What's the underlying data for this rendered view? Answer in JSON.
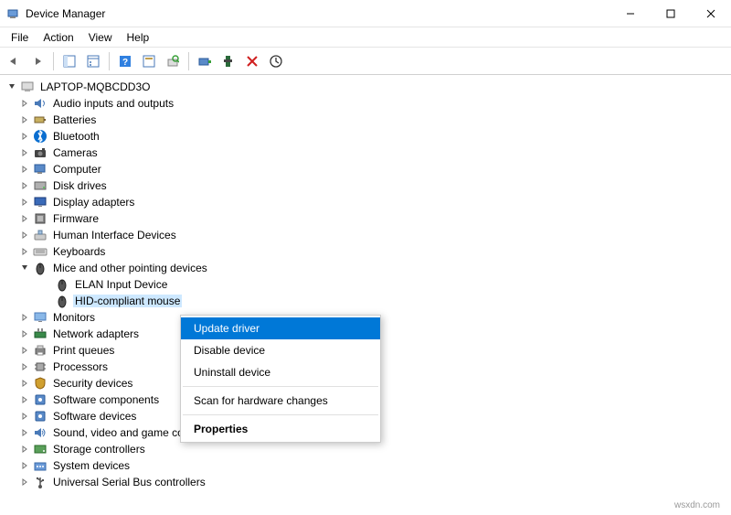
{
  "title": "Device Manager",
  "menubar": [
    "File",
    "Action",
    "View",
    "Help"
  ],
  "root": "LAPTOP-MQBCDD3O",
  "categories": [
    {
      "label": "Audio inputs and outputs",
      "icon": "audio"
    },
    {
      "label": "Batteries",
      "icon": "battery"
    },
    {
      "label": "Bluetooth",
      "icon": "bluetooth"
    },
    {
      "label": "Cameras",
      "icon": "camera"
    },
    {
      "label": "Computer",
      "icon": "computer"
    },
    {
      "label": "Disk drives",
      "icon": "disk"
    },
    {
      "label": "Display adapters",
      "icon": "display"
    },
    {
      "label": "Firmware",
      "icon": "firmware"
    },
    {
      "label": "Human Interface Devices",
      "icon": "hid"
    },
    {
      "label": "Keyboards",
      "icon": "keyboard"
    },
    {
      "label": "Mice and other pointing devices",
      "icon": "mouse",
      "expanded": true,
      "children": [
        {
          "label": "ELAN Input Device",
          "icon": "mouse"
        },
        {
          "label": "HID-compliant mouse",
          "icon": "mouse",
          "selected": true
        }
      ]
    },
    {
      "label": "Monitors",
      "icon": "monitor"
    },
    {
      "label": "Network adapters",
      "icon": "network"
    },
    {
      "label": "Print queues",
      "icon": "printer"
    },
    {
      "label": "Processors",
      "icon": "cpu"
    },
    {
      "label": "Security devices",
      "icon": "security"
    },
    {
      "label": "Software components",
      "icon": "software"
    },
    {
      "label": "Software devices",
      "icon": "software"
    },
    {
      "label": "Sound, video and game controllers",
      "icon": "sound"
    },
    {
      "label": "Storage controllers",
      "icon": "storage"
    },
    {
      "label": "System devices",
      "icon": "system"
    },
    {
      "label": "Universal Serial Bus controllers",
      "icon": "usb"
    }
  ],
  "context_menu": [
    {
      "label": "Update driver",
      "highlighted": true
    },
    {
      "label": "Disable device"
    },
    {
      "label": "Uninstall device"
    },
    {
      "sep": true
    },
    {
      "label": "Scan for hardware changes"
    },
    {
      "sep": true
    },
    {
      "label": "Properties",
      "bold": true
    }
  ],
  "watermark": "wsxdn.com"
}
